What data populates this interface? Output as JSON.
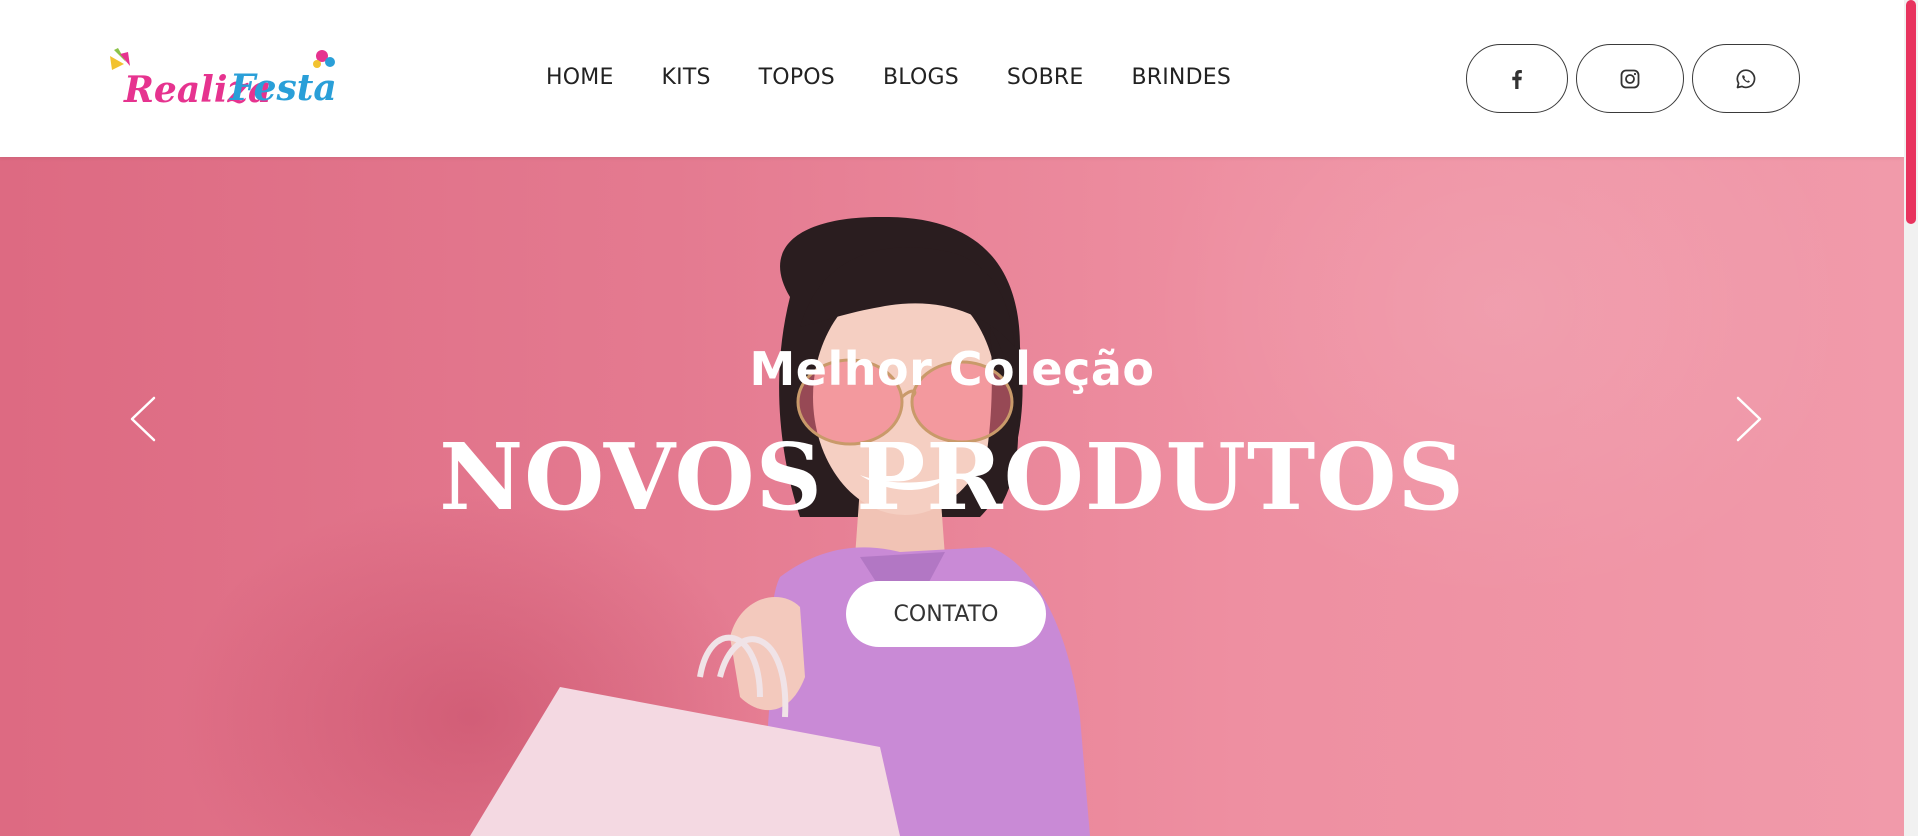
{
  "brand": {
    "logo_text_1": "Realiza",
    "logo_text_2": "Festa",
    "logo_color_1": "#e6338f",
    "logo_color_2": "#2a9fd8"
  },
  "nav": {
    "items": [
      {
        "label": "HOME"
      },
      {
        "label": "KITS"
      },
      {
        "label": "TOPOS"
      },
      {
        "label": "BLOGS"
      },
      {
        "label": "SOBRE"
      },
      {
        "label": "BRINDES"
      }
    ]
  },
  "social": {
    "items": [
      {
        "icon": "facebook-icon"
      },
      {
        "icon": "instagram-icon"
      },
      {
        "icon": "whatsapp-icon"
      }
    ]
  },
  "hero": {
    "subtitle": "Melhor Coleção",
    "title": "NOVOS PRODUTOS",
    "cta_label": "CONTATO",
    "prev_icon": "chevron-left-icon",
    "next_icon": "chevron-right-icon"
  },
  "colors": {
    "accent": "#e8335e",
    "hero_bg": "#e47a90"
  }
}
